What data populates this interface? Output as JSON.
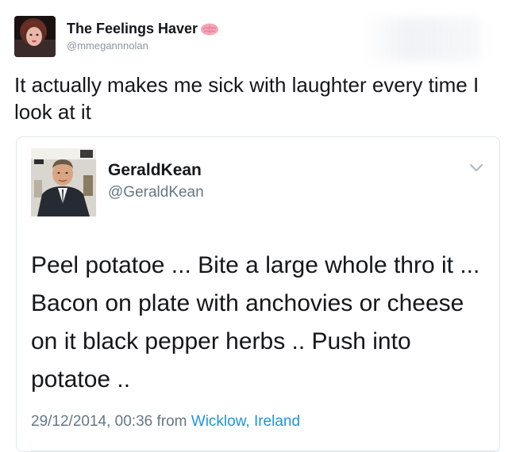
{
  "outer_tweet": {
    "display_name": "The Feelings Haver",
    "handle": "@mmegannnolan",
    "text": "It actually makes me sick with laughter every time I look at it",
    "emoji_icon": "brain-icon",
    "avatar_icon": "user-avatar"
  },
  "quoted_tweet": {
    "display_name": "GeraldKean",
    "handle": "@GeraldKean",
    "text": "Peel potatoe ... Bite a large whole thro it ... Bacon on plate with anchovies or cheese on it black pepper herbs .. Push into potatoe  ..",
    "timestamp": "29/12/2014, 00:36",
    "from_label": "from",
    "location": "Wicklow, Ireland",
    "menu_icon": "chevron-down-icon",
    "avatar_icon": "user-avatar"
  },
  "colors": {
    "text": "#14171a",
    "secondary": "#657786",
    "link": "#1b95e0",
    "border": "#e1e8ed",
    "emoji": "#f4a6b7"
  }
}
